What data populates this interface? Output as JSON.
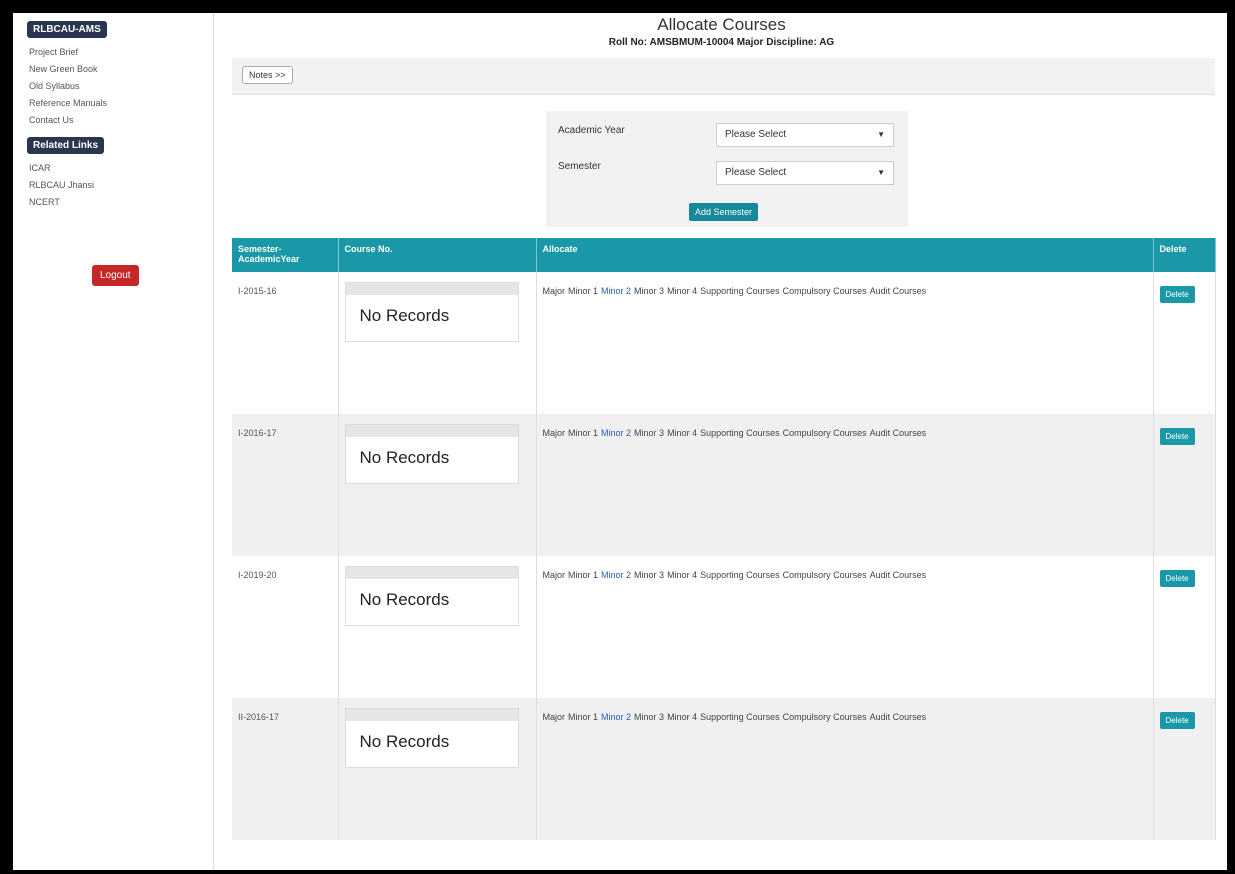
{
  "sidebar": {
    "section1_title": "RLBCAU-AMS",
    "links1": [
      "Project Brief",
      "New Green Book",
      "Old Syllabus",
      "Reference Manuals",
      "Contact Us"
    ],
    "section2_title": "Related Links",
    "links2": [
      "ICAR",
      "RLBCAU Jhansi",
      "NCERT"
    ],
    "logout_label": "Logout"
  },
  "header": {
    "title": "Allocate Courses",
    "subtitle": "Roll No: AMSBMUM-10004 Major Discipline: AG"
  },
  "notes_button": "Notes >>",
  "filters": {
    "academic_year_label": "Academic Year",
    "academic_year_value": "Please Select",
    "semester_label": "Semester",
    "semester_value": "Please Select",
    "add_button": "Add Semester"
  },
  "table": {
    "headers": [
      "Semester-AcademicYear",
      "Course No.",
      "Allocate",
      "Delete"
    ],
    "rows": [
      {
        "semester": "I-2015-16",
        "course": "No Records",
        "delete": "Delete"
      },
      {
        "semester": "I-2016-17",
        "course": "No Records",
        "delete": "Delete"
      },
      {
        "semester": "I-2019-20",
        "course": "No Records",
        "delete": "Delete"
      },
      {
        "semester": "II-2016-17",
        "course": "No Records",
        "delete": "Delete"
      }
    ],
    "allocate_links": [
      "Major",
      "Minor 1",
      "Minor 2",
      "Minor 3",
      "Minor 4",
      "Supporting Courses",
      "Compulsory Courses",
      "Audit Courses"
    ]
  }
}
